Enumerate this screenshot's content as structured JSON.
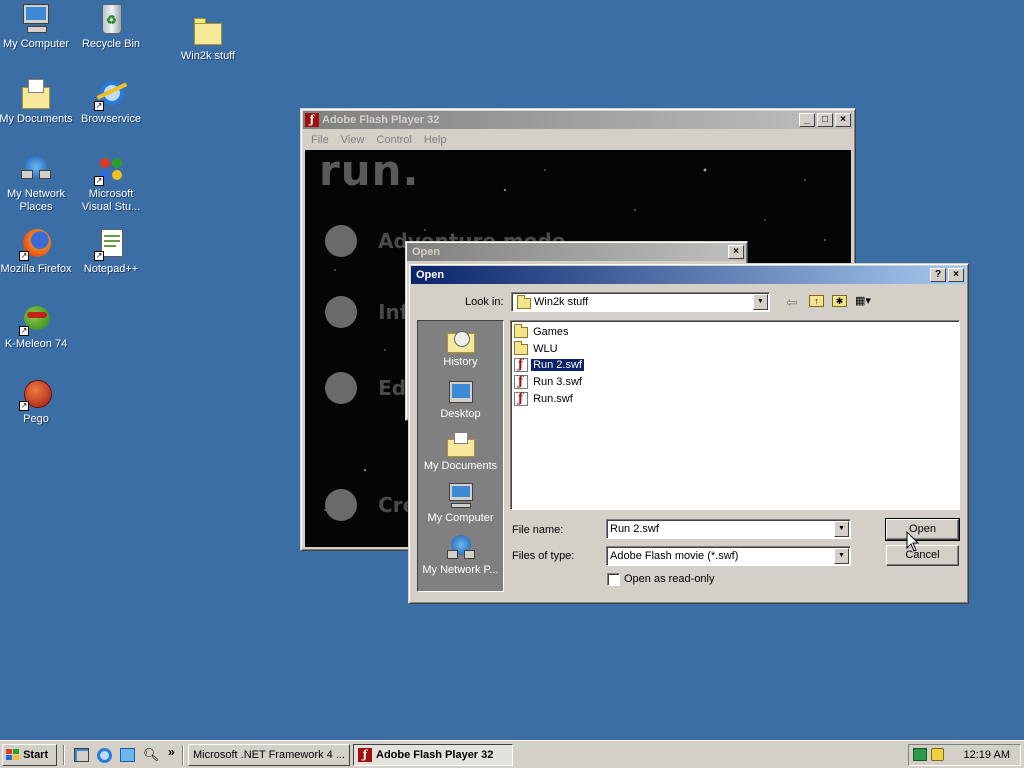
{
  "desktop": {
    "icons": [
      {
        "label": "My Computer"
      },
      {
        "label": "Recycle Bin"
      },
      {
        "label": "Win2k stuff"
      },
      {
        "label": "My Documents"
      },
      {
        "label": "Browservice"
      },
      {
        "label": "My Network Places"
      },
      {
        "label": "Microsoft Visual Stu..."
      },
      {
        "label": "Mozilla Firefox"
      },
      {
        "label": "Notepad++"
      },
      {
        "label": "K-Meleon 74"
      },
      {
        "label": "Pego"
      }
    ]
  },
  "flash_window": {
    "title": "Adobe Flash Player 32",
    "menu": [
      "File",
      "View",
      "Control",
      "Help"
    ],
    "game_title": "run.",
    "menu_items": [
      "Adventure mode",
      "Infinite",
      "Editor",
      "Credits"
    ]
  },
  "small_open": {
    "title": "Open"
  },
  "open_dialog": {
    "title": "Open",
    "look_in_label": "Look in:",
    "look_in_value": "Win2k stuff",
    "places": [
      "History",
      "Desktop",
      "My Documents",
      "My Computer",
      "My Network P..."
    ],
    "files": [
      {
        "name": "Games",
        "type": "folder"
      },
      {
        "name": "WLU",
        "type": "folder"
      },
      {
        "name": "Run 2.swf",
        "type": "swf",
        "selected": true
      },
      {
        "name": "Run 3.swf",
        "type": "swf"
      },
      {
        "name": "Run.swf",
        "type": "swf"
      }
    ],
    "file_name_label": "File name:",
    "file_name_value": "Run 2.swf",
    "file_type_label": "Files of type:",
    "file_type_value": "Adobe Flash movie (*.swf)",
    "readonly_label": "Open as read-only",
    "open_button": "Open",
    "cancel_button": "Cancel",
    "help_glyph": "?",
    "close_glyph": "×"
  },
  "taskbar": {
    "start_label": "Start",
    "tasks": [
      "Microsoft .NET Framework 4 ...",
      "Adobe Flash Player 32"
    ],
    "quicklaunch_more": "»",
    "clock": "12:19 AM"
  },
  "colors": {
    "desktop": "#3a6ea5",
    "title_active": "#0a246a",
    "selection": "#0a246a"
  }
}
